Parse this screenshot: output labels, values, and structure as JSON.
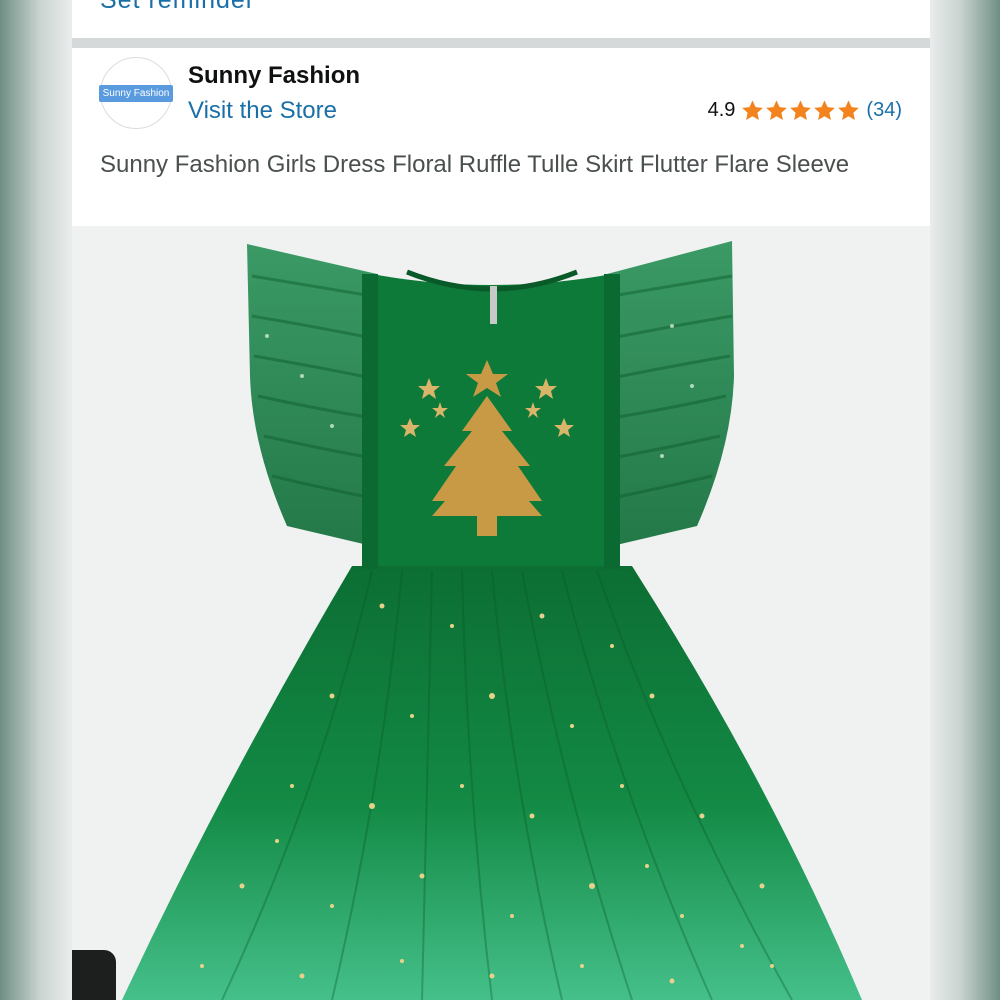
{
  "reminder": {
    "label": "Set reminder"
  },
  "store": {
    "logo_text": "Sunny Fashion",
    "name": "Sunny Fashion",
    "visit_label": "Visit the Store",
    "rating": "4.9",
    "rating_count": "(34)",
    "star_color": "#f3841d",
    "link_color": "#1a6fa8"
  },
  "product": {
    "title": "Sunny Fashion Girls Dress Floral Ruffle Tulle Skirt Flutter Flare Sleeve",
    "dress_color": "#0f7d3b",
    "tree_color": "#c99a45"
  }
}
